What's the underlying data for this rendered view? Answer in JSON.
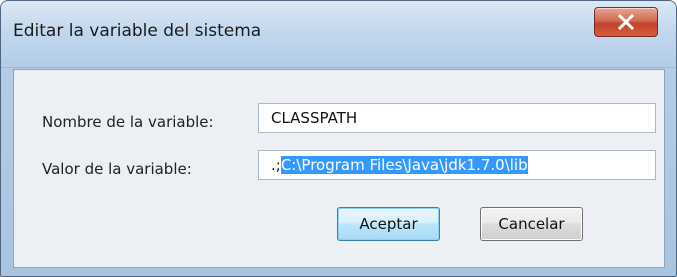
{
  "window": {
    "title": "Editar la variable del sistema"
  },
  "form": {
    "name_label": "Nombre de la variable:",
    "name_value": "CLASSPATH",
    "value_label": "Valor de la variable:",
    "value_prefix": ".;",
    "value_selected": "C:\\Program Files\\Java\\jdk1.7.0\\lib"
  },
  "buttons": {
    "ok_label": "Aceptar",
    "cancel_label": "Cancelar"
  },
  "icons": {
    "close": "close-icon"
  },
  "colors": {
    "selection": "#3399ff",
    "close_button": "#c0432b",
    "title_bar": "#c3d8ee"
  }
}
